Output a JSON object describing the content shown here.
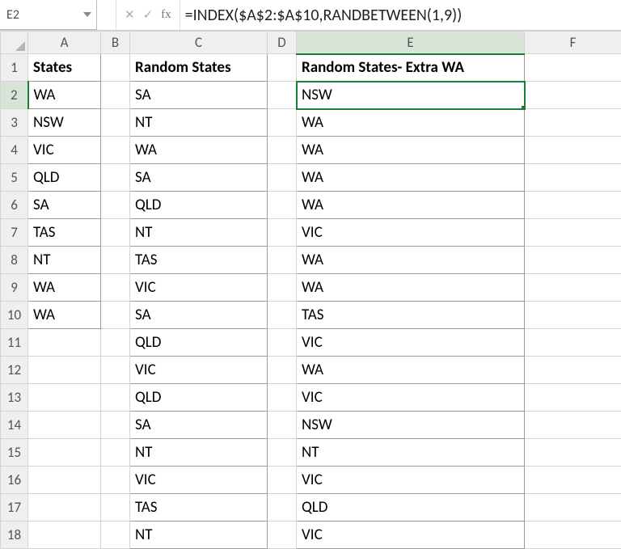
{
  "name_box": "E2",
  "formula": "=INDEX($A$2:$A$10,RANDBETWEEN(1,9))",
  "active_cell": {
    "col": "E",
    "row": 2
  },
  "columns": [
    "A",
    "B",
    "C",
    "D",
    "E",
    "F"
  ],
  "row_count": 18,
  "headers": {
    "A1": "States",
    "C1": "Random States",
    "E1": "Random States- Extra WA"
  },
  "colA": [
    "WA",
    "NSW",
    "VIC",
    "QLD",
    "SA",
    "TAS",
    "NT",
    "WA",
    "WA"
  ],
  "colC": [
    "SA",
    "NT",
    "WA",
    "SA",
    "QLD",
    "NT",
    "TAS",
    "VIC",
    "SA",
    "QLD",
    "VIC",
    "QLD",
    "SA",
    "NT",
    "VIC",
    "TAS",
    "NT"
  ],
  "colE": [
    "NSW",
    "WA",
    "WA",
    "WA",
    "WA",
    "VIC",
    "WA",
    "WA",
    "TAS",
    "VIC",
    "WA",
    "VIC",
    "NSW",
    "NT",
    "VIC",
    "QLD",
    "VIC"
  ]
}
